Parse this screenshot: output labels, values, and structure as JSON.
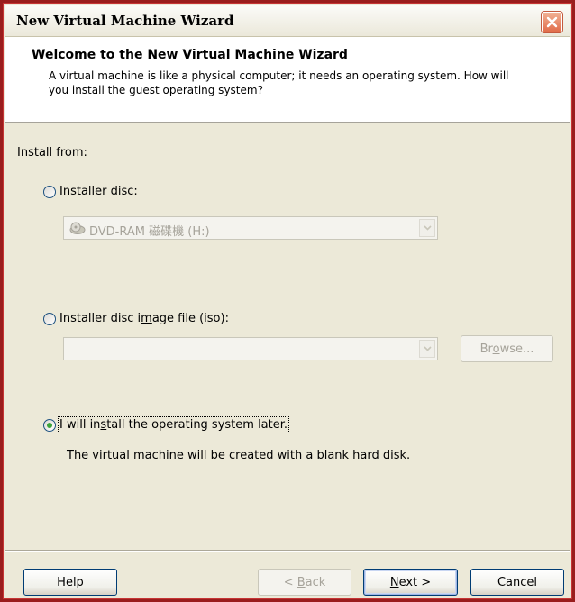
{
  "window": {
    "title": "New Virtual Machine Wizard",
    "close_icon": "close-icon"
  },
  "header": {
    "title": "Welcome to the New Virtual Machine Wizard",
    "description": "A virtual machine is like a physical computer; it needs an operating system. How will you install the guest operating system?"
  },
  "install": {
    "label": "Install from:",
    "disc": {
      "label_prefix": "Installer ",
      "label_mnemonic": "d",
      "label_suffix": "isc:",
      "selected": false,
      "drive_value": "DVD-RAM 磁碟機 (H:)",
      "drive_icon": "dvd-drive-icon"
    },
    "iso": {
      "label_prefix": "Installer disc i",
      "label_mnemonic": "m",
      "label_suffix": "age file (iso):",
      "selected": false,
      "path_value": "",
      "browse_prefix": "Br",
      "browse_mnemonic": "o",
      "browse_suffix": "wse..."
    },
    "later": {
      "label_prefix": "I will in",
      "label_mnemonic": "s",
      "label_suffix": "tall the operating system later.",
      "selected": true,
      "note": "The virtual machine will be created with a blank hard disk."
    }
  },
  "footer": {
    "help_label": "Help",
    "back_prefix": "< ",
    "back_mnemonic": "B",
    "back_suffix": "ack",
    "next_mnemonic": "N",
    "next_suffix": "ext >",
    "cancel_label": "Cancel"
  },
  "colors": {
    "frame": "#9a1d1d",
    "radio_checked": "#3ba43b",
    "close_button": "#e16d4b"
  }
}
